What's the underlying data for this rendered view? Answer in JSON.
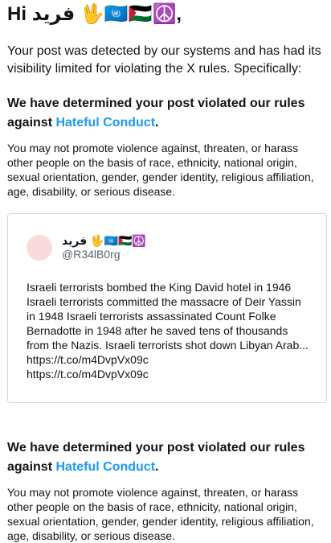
{
  "greeting": "Hi فريد 🖖🇺🇳🇵🇸☮️,",
  "intro": "Your post was detected by our systems and has had its visibility limited for violating the X rules. Specifically:",
  "violations": [
    {
      "heading_prefix": "We have determined your post violated our rules against ",
      "rule_link": "Hateful Conduct",
      "heading_suffix": ".",
      "description": "You may not promote violence against, threaten, or harass other people on the basis of race, ethnicity, national origin, sexual orientation, gender, gender identity, religious affiliation, age, disability, or serious disease."
    },
    {
      "heading_prefix": "We have determined your post violated our rules against ",
      "rule_link": "Hateful Conduct",
      "heading_suffix": ".",
      "description": "You may not promote violence against, threaten, or harass other people on the basis of race, ethnicity, national origin, sexual orientation, gender, gender identity, religious affiliation, age, disability, or serious disease."
    }
  ],
  "post": {
    "author_name": "فريد 🖖🇺🇳🇵🇸☮️",
    "author_handle": "@R34lB0rg",
    "text": "Israeli terrorists bombed the King David hotel in 1946 Israeli terrorists committed the massacre of Deir Yassin in 1948 Israeli terrorists assassinated Count Folke Bernadotte in 1948 after he saved tens of thousands from the Nazis. Israeli terrorists shot down Libyan Arab... https://t.co/m4DvpVx09c",
    "link": "https://t.co/m4DvpVx09c"
  },
  "colors": {
    "link": "#1d9bf0",
    "avatar": "#fadadd",
    "border": "#cfd9de"
  }
}
